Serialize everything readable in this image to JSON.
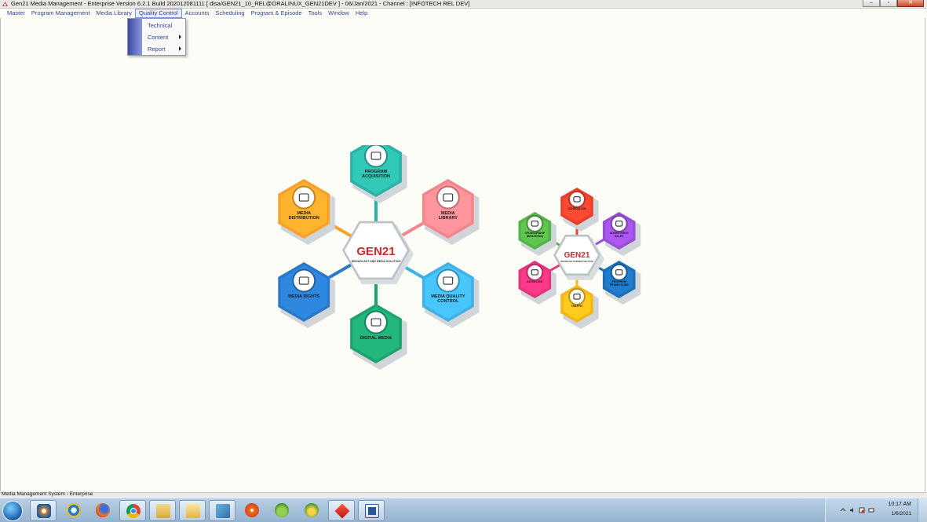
{
  "window": {
    "title": "Gen21 Media Management - Enterprise Version 6.2.1 Build 202012081111 [ disa/GEN21_10_REL@ORALINUX_GEN21DEV ] - 06/Jan/2021 - Channel : [INFOTECH REL DEV]"
  },
  "menu": {
    "items": [
      "Master",
      "Program Management",
      "Media Library",
      "Quality Control",
      "Accounts",
      "Scheduling",
      "Program & Episode",
      "Tools",
      "Window",
      "Help"
    ],
    "active": "Quality Control"
  },
  "dropdown": {
    "items": [
      {
        "label": "Technical",
        "submenu": false
      },
      {
        "label": "Content",
        "submenu": true
      },
      {
        "label": "Report",
        "submenu": true
      }
    ]
  },
  "logo_left": {
    "center_title": "GEN21",
    "center_sub": "BROADCAST AND MEDIA SOLUTION",
    "nodes": [
      {
        "label": "PROGRAM\nACQUISITION",
        "color": "#2bb3a3",
        "icon": "handshake-icon"
      },
      {
        "label": "MEDIA\nLIBRARY",
        "color": "#f2868c",
        "icon": "media-library-icon"
      },
      {
        "label": "MEDIA QUALITY\nCONTROL",
        "color": "#3fb1e6",
        "icon": "quality-control-icon"
      },
      {
        "label": "DIGITAL MEDIA",
        "color": "#1ea36e",
        "icon": "play-icon"
      },
      {
        "label": "MEDIA RIGHTS",
        "color": "#2a79c8",
        "icon": "thumbs-up-icon"
      },
      {
        "label": "MEDIA\nDISTRIBUTION",
        "color": "#f7a12b",
        "icon": "distribution-icon"
      }
    ]
  },
  "logo_right": {
    "center_title": "GEN21",
    "center_sub": "BROADCAST BUSINESS SOLUTION",
    "nodes": [
      {
        "label": "SCHEDULING",
        "color": "#e6412d",
        "icon": "calendar-icon"
      },
      {
        "label": "ADVERTISING\nSALES",
        "color": "#9b4fd6",
        "icon": "sales-icon"
      },
      {
        "label": "PROGRAM\nPROMOTIONS",
        "color": "#1d6fb8",
        "icon": "megaphone-icon"
      },
      {
        "label": "TRAFFIC",
        "color": "#f5b51c",
        "icon": "tv-icon"
      },
      {
        "label": "AD BILLING",
        "color": "#e8337d",
        "icon": "billing-icon"
      },
      {
        "label": "SPONSORSHIP\n(BRANDING)",
        "color": "#55b247",
        "icon": "target-icon"
      }
    ]
  },
  "status": {
    "text": "Media Management System - Enterprise"
  },
  "taskbar": {
    "icons": [
      "start-orb-icon",
      "media-player-icon",
      "internet-explorer-icon",
      "firefox-icon",
      "chrome-icon",
      "file-explorer-icon",
      "outlook-icon",
      "tools-icon",
      "compass-icon",
      "frog-icon",
      "gen21-app-icon",
      "diamond-app-icon",
      "word-icon"
    ],
    "clock_time": "10:17 AM",
    "clock_date": "1/6/2021"
  }
}
